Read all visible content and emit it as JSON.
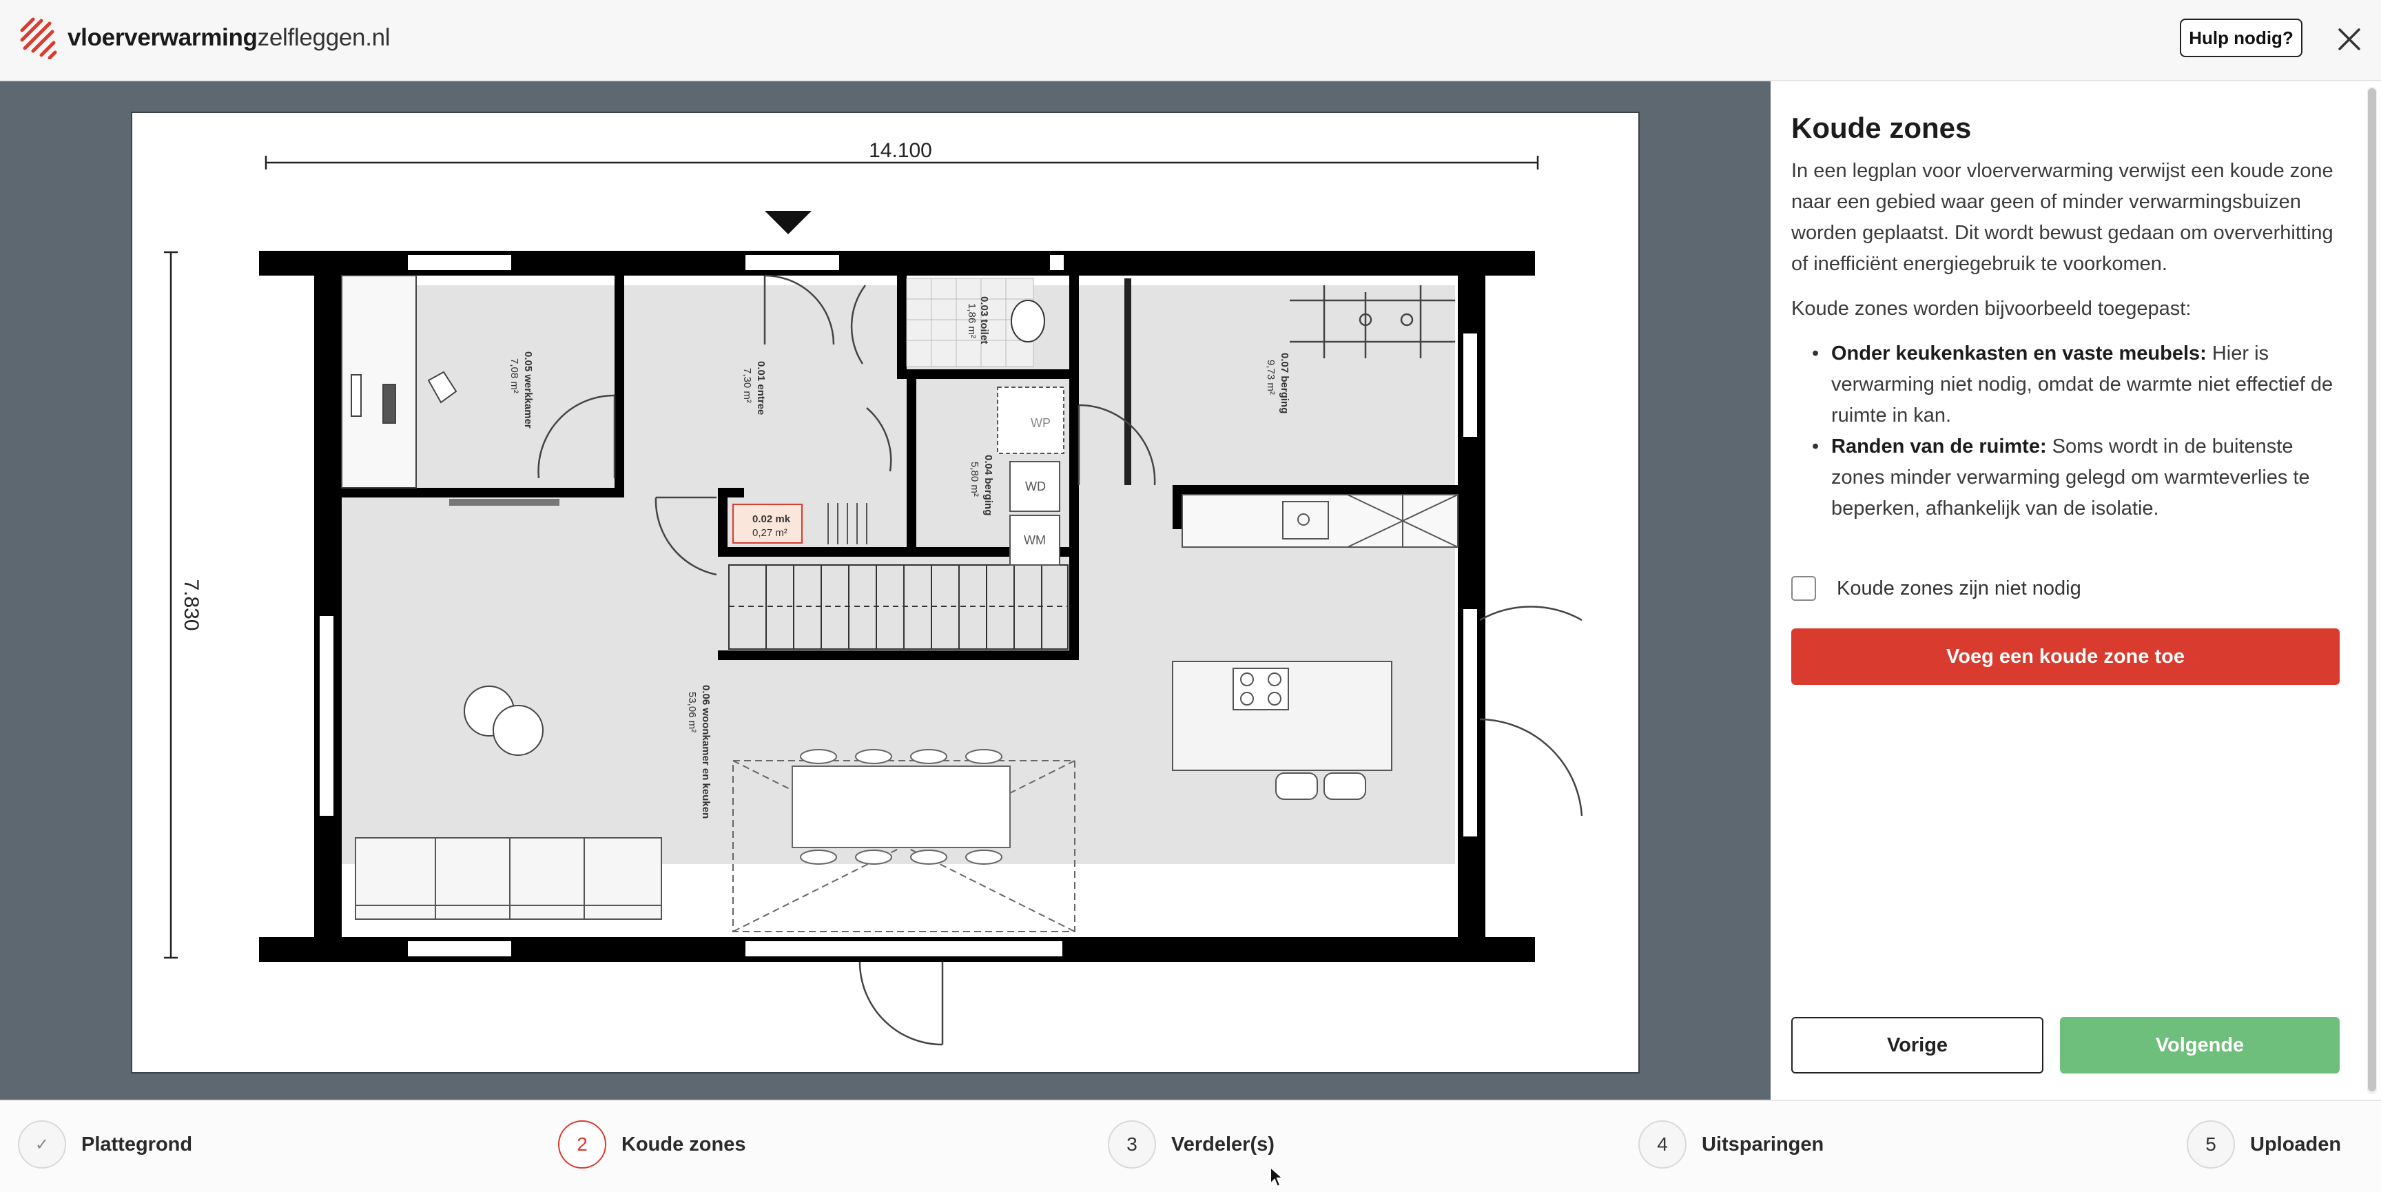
{
  "header": {
    "logo_bold": "vloerverwarming",
    "logo_light": "zelfleggen.nl",
    "help_label": "Hulp nodig?",
    "close_icon": "close-icon",
    "brand_color": "#d93b2e"
  },
  "plan": {
    "width_dim": "14.100",
    "height_dim": "7.830",
    "rooms": [
      {
        "name": "0.05 werkkamer",
        "area": "7,08 m²"
      },
      {
        "name": "0.01 entree",
        "area": "7,30 m²"
      },
      {
        "name": "0.03 toilet",
        "area": "1,86 m²"
      },
      {
        "name": "0.07 berging",
        "area": "9,73 m²"
      },
      {
        "name": "0.04 berging",
        "area": "5,80 m²"
      },
      {
        "name": "0.02 mk",
        "area": "0,27 m²"
      },
      {
        "name": "0.06 woonkamer en keuken",
        "area": "53,06 m²"
      }
    ],
    "appliance_labels": [
      "WP",
      "WD",
      "WM"
    ]
  },
  "panel": {
    "title": "Koude zones",
    "intro": "In een legplan voor vloerverwarming verwijst een koude zone naar een gebied waar geen of minder verwarmingsbuizen worden geplaatst. Dit wordt bewust gedaan om oververhitting of inefficiënt energiegebruik te voorkomen.",
    "examples_intro": "Koude zones worden bijvoorbeeld toegepast:",
    "bullets": [
      {
        "bold": "Onder keukenkasten en vaste meubels:",
        "text": " Hier is verwarming niet nodig, omdat de warmte niet effectief de ruimte in kan."
      },
      {
        "bold": "Randen van de ruimte:",
        "text": " Soms wordt in de buitenste zones minder verwarming gelegd om warmteverlies te beperken, afhankelijk van de isolatie."
      }
    ],
    "checkbox_label": "Koude zones zijn niet nodig",
    "add_button": "Voeg een koude zone toe",
    "prev_button": "Vorige",
    "next_button": "Volgende"
  },
  "steps": [
    {
      "number": "✓",
      "label": "Plattegrond"
    },
    {
      "number": "2",
      "label": "Koude zones"
    },
    {
      "number": "3",
      "label": "Verdeler(s)"
    },
    {
      "number": "4",
      "label": "Uitsparingen"
    },
    {
      "number": "5",
      "label": "Uploaden"
    }
  ]
}
